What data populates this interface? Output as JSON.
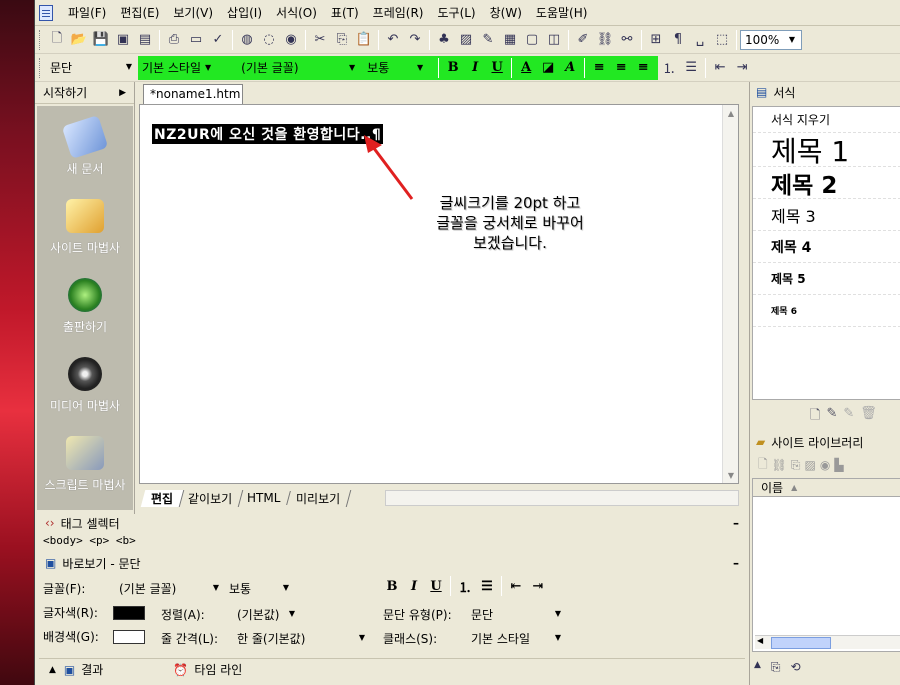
{
  "menu": {
    "items": [
      "파일(F)",
      "편집(E)",
      "보기(V)",
      "삽입(I)",
      "서식(O)",
      "표(T)",
      "프레임(R)",
      "도구(L)",
      "창(W)",
      "도움말(H)"
    ]
  },
  "toolbar": {
    "zoom": "100%",
    "paragraph_combo": "문단",
    "style_combo": "기본 스타일",
    "font_combo": "(기본 글꼴)",
    "size_combo": "보통",
    "bold": "B",
    "italic": "I",
    "underline": "U",
    "font_color": "A",
    "accent_green": "#22e822"
  },
  "left_panel": {
    "start_label": "시작하기",
    "wizards": [
      "새 문서",
      "사이트 마법사",
      "출판하기",
      "미디어 마법사",
      "스크립트 마법사"
    ]
  },
  "editor": {
    "tab_label": "*noname1.htm",
    "selected_text": "NZ2UR에 오신 것을 환영합니다..¶",
    "note_lines": [
      "글씨크기를 20pt 하고",
      "글꼴을 궁서체로 바꾸어",
      "보겠습니다."
    ],
    "view_tabs": [
      "편집",
      "같이보기",
      "HTML",
      "미리보기"
    ]
  },
  "tag_selector": {
    "title": "태그 셀렉터",
    "path": "<body> <p> <b>"
  },
  "properties": {
    "title": "바로보기 - 문단",
    "font_label": "글꼴(F):",
    "font_value": "(기본 글꼴)",
    "size_value": "보통",
    "color_label": "글자색(R):",
    "align_label": "정렬(A):",
    "align_value": "(기본값)",
    "para_type_label": "문단 유형(P):",
    "para_type_value": "문단",
    "bg_label": "배경색(G):",
    "line_spacing_label": "줄 간격(L):",
    "line_spacing_value": "한 줄(기본값)",
    "class_label": "클래스(S):",
    "class_value": "기본 스타일",
    "bold": "B",
    "italic": "I",
    "underline": "U"
  },
  "bottom_bar": {
    "result": "결과",
    "timeline": "타임 라인"
  },
  "right_panel": {
    "styles_title": "서식",
    "clear_format": "서식 지우기",
    "headings": [
      "제목 1",
      "제목 2",
      "제목 3",
      "제목 4",
      "제목 5",
      "제목 6"
    ],
    "library_title": "사이트 라이브러리",
    "library_column": "이름"
  }
}
